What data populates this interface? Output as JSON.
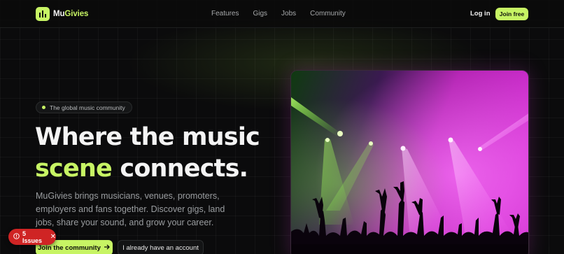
{
  "brand": {
    "name_part1": "Mu",
    "name_part2": "Givies",
    "logo_icon": "bars-icon"
  },
  "nav": {
    "links": [
      "Features",
      "Gigs",
      "Jobs",
      "Community"
    ],
    "login": "Log in",
    "join_free": "Join free"
  },
  "hero": {
    "badge": "The global music community",
    "headline_line1": "Where the music",
    "headline_accent": "scene",
    "headline_rest": " connects.",
    "description": "MuGivies brings musicians, venues, promoters, employers and fans together. Discover gigs, land jobs, share your sound, and grow your career.",
    "primary_cta": "Join the community",
    "primary_cta_icon": "arrow-right-icon",
    "secondary_cta": "I already have an account"
  },
  "issues_badge": {
    "label": "5 Issues",
    "icon": "alert-circle-icon",
    "close_icon": "close-icon"
  },
  "colors": {
    "accent": "#c7f464",
    "background": "#0b0b0c",
    "issues": "#cf2424",
    "magenta": "#e040e0",
    "green_beam": "#7cff3a"
  }
}
